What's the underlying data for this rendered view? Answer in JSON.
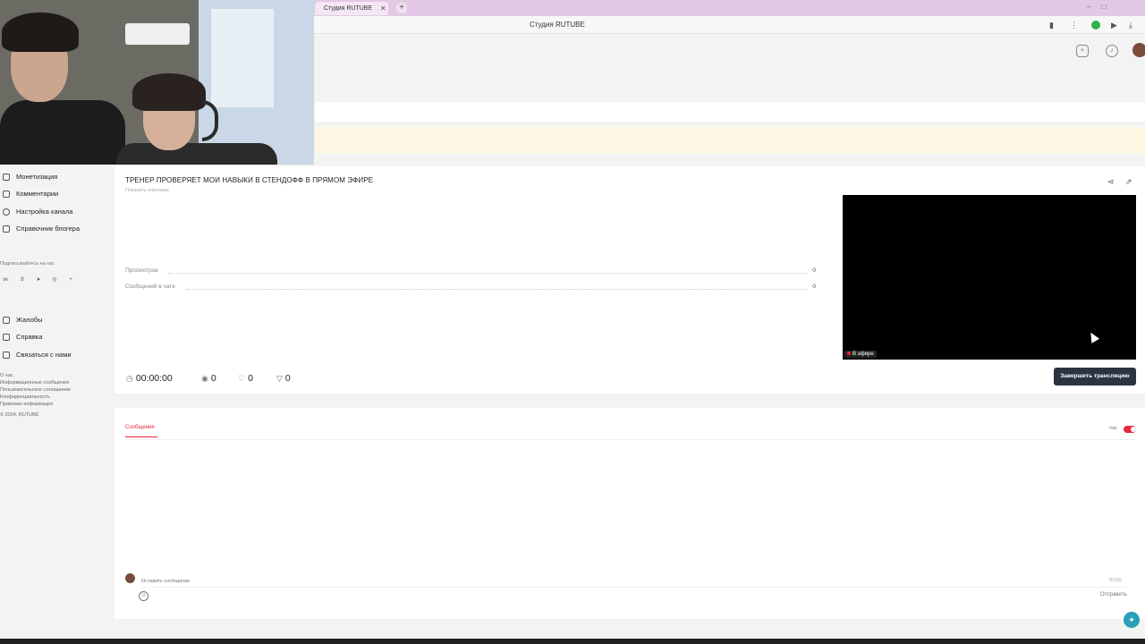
{
  "browser": {
    "tab_title": "Студия RUTUBE",
    "tab_close": "✕",
    "new_tab": "+",
    "window_controls": "–□",
    "address_title": "Студия RUTUBE"
  },
  "sidebar": {
    "items": [
      {
        "label": "Монетизация"
      },
      {
        "label": "Комментарии"
      },
      {
        "label": "Настройка канала"
      },
      {
        "label": "Справочник блогера"
      }
    ],
    "follow_label": "Подписывайтесь на нас",
    "socials": [
      "vk",
      "ok",
      "tg",
      "vb",
      "+"
    ],
    "bottom_items": [
      {
        "label": "Жалобы"
      },
      {
        "label": "Справка"
      },
      {
        "label": "Связаться с нами"
      }
    ],
    "footer_links": [
      "О нас",
      "Информационные сообщения",
      "Пользовательское соглашение",
      "Конфиденциальность",
      "Правовая информация",
      "© 2024, RUTUBE"
    ]
  },
  "stream": {
    "title": "ТРЕНЕР ПРОВЕРЯЕТ МОИ НАВЫКИ В СТЕНДОФФ В ПРЯМОМ ЭФИРЕ",
    "show_description": "Показать описание",
    "stats": [
      {
        "label": "Просмотров",
        "value": "0"
      },
      {
        "label": "Сообщений в чате",
        "value": "0"
      }
    ],
    "live_badge": "В эфире",
    "duration": "00:00:00",
    "viewers": "0",
    "likes": "0",
    "dislikes": "0",
    "end_button": "Завершить трансляцию"
  },
  "chat": {
    "tab_label": "Сообщения",
    "toggle_label": "Чат",
    "toggle_on": true,
    "input_placeholder": "Оставить сообщение",
    "char_count": "0/200",
    "send_label": "Отправить"
  },
  "colors": {
    "accent": "#e5293c",
    "end_button_bg": "#2b3441",
    "tabbar": "#e3c9e6"
  }
}
